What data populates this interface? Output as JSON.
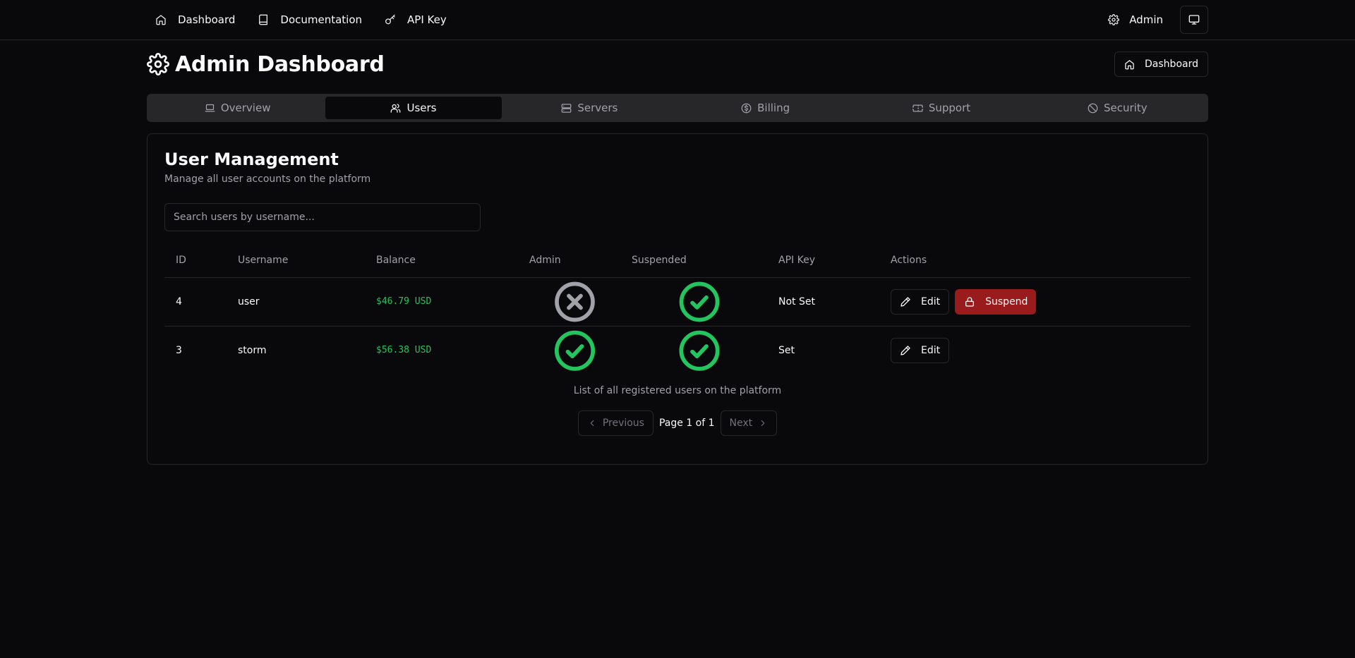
{
  "nav": {
    "links": [
      {
        "label": "Dashboard",
        "icon": "home-icon"
      },
      {
        "label": "Documentation",
        "icon": "book-icon"
      },
      {
        "label": "API Key",
        "icon": "key-icon"
      }
    ],
    "admin_label": "Admin",
    "admin_icon": "gear-icon",
    "theme_icon": "monitor-icon"
  },
  "header": {
    "title": "Admin Dashboard",
    "dashboard_button": "Dashboard"
  },
  "tabs": [
    {
      "label": "Overview",
      "icon": "laptop-icon",
      "active": false
    },
    {
      "label": "Users",
      "icon": "users-icon",
      "active": true
    },
    {
      "label": "Servers",
      "icon": "server-icon",
      "active": false
    },
    {
      "label": "Billing",
      "icon": "dollar-circle-icon",
      "active": false
    },
    {
      "label": "Support",
      "icon": "ticket-icon",
      "active": false
    },
    {
      "label": "Security",
      "icon": "ban-icon",
      "active": false
    }
  ],
  "users": {
    "title": "User Management",
    "description": "Manage all user accounts on the platform",
    "search_placeholder": "Search users by username...",
    "columns": [
      "ID",
      "Username",
      "Balance",
      "Admin",
      "Suspended",
      "API Key",
      "Actions"
    ],
    "rows": [
      {
        "id": "4",
        "username": "user",
        "balance": "$46.79 USD",
        "admin": false,
        "suspended": true,
        "api_key": "Not Set",
        "edit": "Edit",
        "suspend": "Suspend"
      },
      {
        "id": "3",
        "username": "storm",
        "balance": "$56.38 USD",
        "admin": true,
        "suspended": true,
        "api_key": "Set",
        "edit": "Edit"
      }
    ],
    "caption": "List of all registered users on the platform",
    "pagination": {
      "previous": "Previous",
      "page": "Page 1 of 1",
      "next": "Next"
    }
  },
  "colors": {
    "background": "#09090b",
    "border": "#27272a",
    "success": "#22c55e",
    "danger": "#991b1b",
    "muted": "#a1a1aa"
  }
}
